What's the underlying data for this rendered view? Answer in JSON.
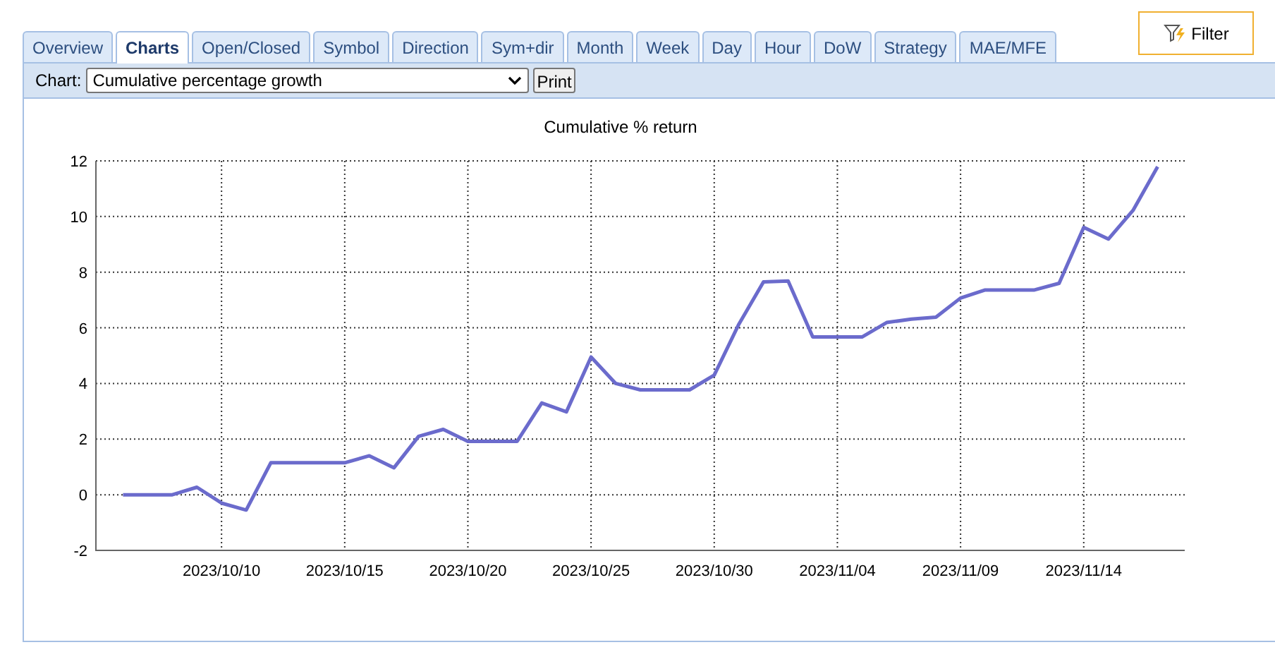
{
  "tabs": [
    {
      "label": "Overview",
      "selected": false
    },
    {
      "label": "Charts",
      "selected": true
    },
    {
      "label": "Open/Closed",
      "selected": false
    },
    {
      "label": "Symbol",
      "selected": false
    },
    {
      "label": "Direction",
      "selected": false
    },
    {
      "label": "Sym+dir",
      "selected": false
    },
    {
      "label": "Month",
      "selected": false
    },
    {
      "label": "Week",
      "selected": false
    },
    {
      "label": "Day",
      "selected": false
    },
    {
      "label": "Hour",
      "selected": false
    },
    {
      "label": "DoW",
      "selected": false
    },
    {
      "label": "Strategy",
      "selected": false
    },
    {
      "label": "MAE/MFE",
      "selected": false
    }
  ],
  "filter_button": {
    "label": "Filter"
  },
  "toolbar": {
    "chart_label": "Chart:",
    "chart_select": {
      "value": "Cumulative percentage growth"
    },
    "print_button": "Print"
  },
  "chart_data": {
    "type": "line",
    "title": "Cumulative % return",
    "grid": true,
    "categories": [
      null,
      null,
      null,
      null,
      "2023/10/10",
      null,
      null,
      null,
      null,
      "2023/10/15",
      null,
      null,
      null,
      null,
      "2023/10/20",
      null,
      null,
      null,
      null,
      "2023/10/25",
      null,
      null,
      null,
      null,
      "2023/10/30",
      null,
      null,
      null,
      null,
      "2023/11/04",
      null,
      null,
      null,
      null,
      "2023/11/09",
      null,
      null,
      null,
      null,
      "2023/11/14",
      null,
      null,
      null
    ],
    "series": [
      {
        "color": "#6b6bcc",
        "values": [
          0,
          0,
          0,
          0.27,
          -0.3,
          -0.55,
          1.15,
          1.15,
          1.15,
          1.15,
          1.4,
          0.97,
          2.1,
          2.35,
          1.92,
          1.92,
          1.92,
          3.3,
          2.98,
          4.95,
          4.0,
          3.77,
          3.77,
          3.77,
          4.3,
          6.13,
          7.65,
          7.68,
          5.67,
          5.67,
          5.67,
          6.19,
          6.31,
          6.38,
          7.07,
          7.36,
          7.36,
          7.36,
          7.6,
          9.61,
          9.19,
          10.22,
          11.79
        ]
      }
    ],
    "ylim": [
      -2,
      12
    ],
    "yticks": [
      -2,
      0,
      2,
      4,
      6,
      8,
      10,
      12
    ]
  }
}
